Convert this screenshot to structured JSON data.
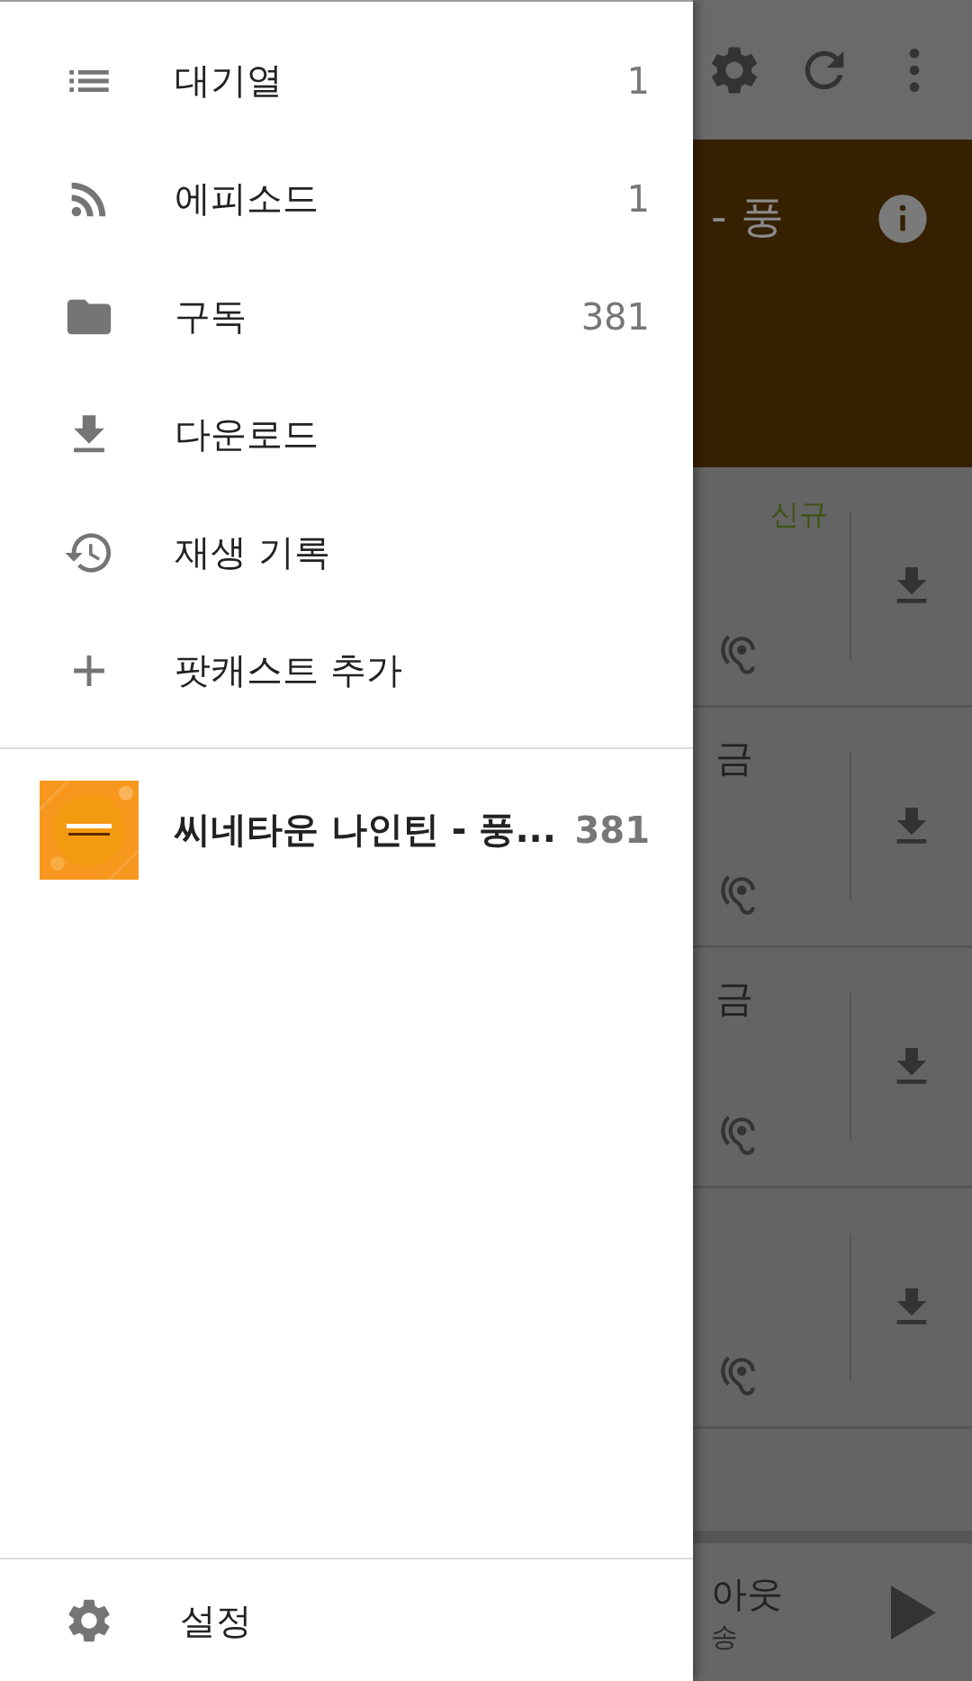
{
  "drawer": {
    "nav_items": [
      {
        "kind": "queue",
        "label": "대기열",
        "count": "1"
      },
      {
        "kind": "episodes",
        "label": "에피소드",
        "count": "1"
      },
      {
        "kind": "subscriptions",
        "label": "구독",
        "count": "381"
      },
      {
        "kind": "downloads",
        "label": "다운로드"
      },
      {
        "kind": "history",
        "label": "재생 기록"
      },
      {
        "kind": "add",
        "label": "팟캐스트 추가"
      }
    ],
    "subscriptions": [
      {
        "kind": "picture",
        "title": "씨네타운 나인틴 - 풍...",
        "count": "381"
      }
    ],
    "footer": {
      "kind": "settings",
      "label": "설정"
    }
  },
  "background": {
    "header": {
      "title": "- 풍"
    },
    "episodes": [
      {
        "kind": "episode",
        "badge": "신규"
      },
      {
        "kind": "episode",
        "title": "금"
      },
      {
        "kind": "episode",
        "title": "금"
      },
      {
        "kind": "episode"
      }
    ],
    "player": {
      "title": "아웃",
      "subtitle": "송"
    }
  }
}
